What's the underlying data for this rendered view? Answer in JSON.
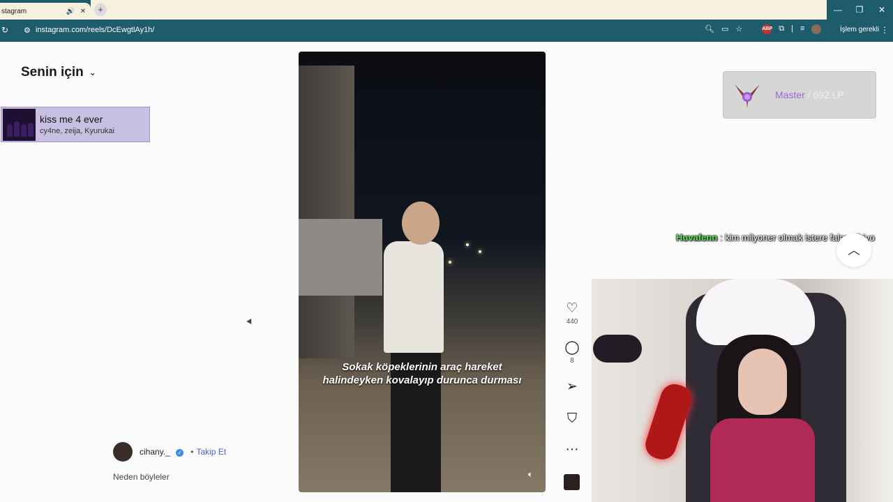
{
  "browser": {
    "tab_title": "stagram",
    "tab_audio_icon": "speaker-icon",
    "tab_close": "✕",
    "new_tab": "+",
    "url": "instagram.com/reels/DcEwgtlAy1h/",
    "action_required": "İşlem gerekli",
    "window_controls": {
      "minimize": "—",
      "restore": "❐",
      "close": "✕"
    }
  },
  "feed": {
    "title": "Senin için"
  },
  "music_card": {
    "title": "kiss me 4 ever",
    "artists": "cy4ne, zeija, Kyurukai"
  },
  "reel": {
    "caption": "Sokak köpeklerinin araç hareket halindeyken kovalayıp durunca durması",
    "likes": "440",
    "comments": "8",
    "author": "cihany._",
    "follow_label": "Takip Et",
    "separator": "•",
    "description": "Neden böyleler"
  },
  "rank_overlay": {
    "tier": "Master",
    "lp": " / 692 LP"
  },
  "chat": {
    "user": "Huvafenn",
    "message": " : kim milyoner olmak istere falan cikiyo"
  },
  "colors": {
    "browser_frame": "#1e5c6b",
    "tab_bg": "#f7f0df",
    "music_card_bg": "#c7c0e3",
    "follow_link": "#4d5bd3",
    "rank_tier": "#9a6bd8",
    "chat_user": "#5fe05f"
  }
}
